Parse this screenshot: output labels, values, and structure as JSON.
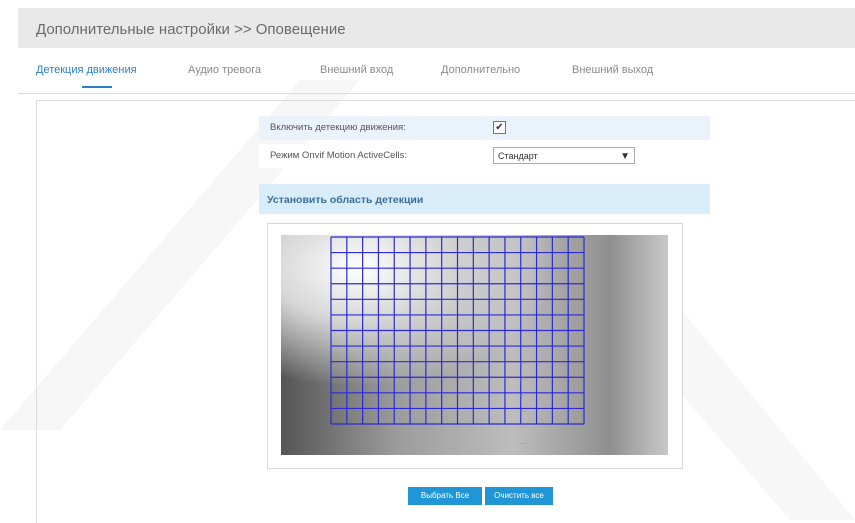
{
  "header": {
    "title": "Дополнительные настройки >> Оповещение"
  },
  "tabs": [
    {
      "label": "Детекция движения",
      "active": true
    },
    {
      "label": "Аудио тревога",
      "active": false
    },
    {
      "label": "Внешний вход",
      "active": false
    },
    {
      "label": "Дополнительно",
      "active": false
    },
    {
      "label": "Внешний выход",
      "active": false
    }
  ],
  "settings": {
    "enable_motion_label": "Включить детекцию движения:",
    "enable_motion_checked": true,
    "onvif_mode_label": "Режим Onvif Motion ActiveCells:",
    "onvif_mode_value": "Стандарт"
  },
  "detection_area": {
    "section_title": "Установить область детекции",
    "grid": {
      "columns": 16,
      "rows": 12
    }
  },
  "video_osd": [
    "...",
    "...",
    "...",
    "...",
    "...",
    "..."
  ],
  "buttons": {
    "select_all": "Выбрать Все",
    "clear_all": "Очистить все"
  },
  "colors": {
    "accent": "#2a7fc8",
    "button": "#2196d6",
    "grid": "#2b2bd6",
    "osd": "#35d335"
  }
}
